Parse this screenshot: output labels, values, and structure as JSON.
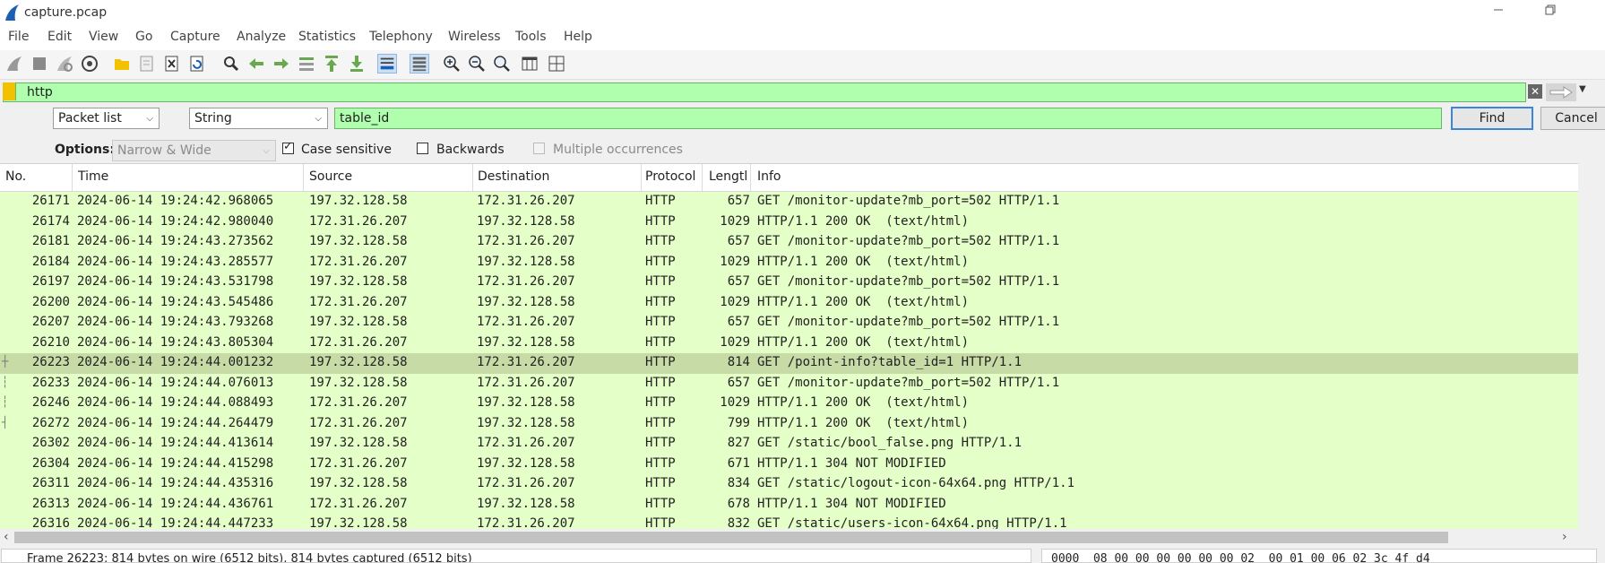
{
  "window": {
    "title": "capture.pcap"
  },
  "menu": [
    "File",
    "Edit",
    "View",
    "Go",
    "Capture",
    "Analyze",
    "Statistics",
    "Telephony",
    "Wireless",
    "Tools",
    "Help"
  ],
  "filter": {
    "value": "http"
  },
  "find": {
    "search_in": "Packet list",
    "search_type": "String",
    "value": "table_id",
    "find_label": "Find",
    "cancel_label": "Cancel",
    "options_label": "Options:",
    "char_width": "Narrow & Wide",
    "case_sensitive_label": "Case sensitive",
    "case_sensitive": true,
    "backwards_label": "Backwards",
    "backwards": false,
    "multiple_label": "Multiple occurrences",
    "multiple": false
  },
  "packet_list": {
    "columns": [
      "No.",
      "Time",
      "Source",
      "Destination",
      "Protocol",
      "Lengtl",
      "Info"
    ],
    "selected_index": 8,
    "rows": [
      {
        "no": "26171",
        "time": "2024-06-14 19:24:42.968065",
        "src": "197.32.128.58",
        "dst": "172.31.26.207",
        "proto": "HTTP",
        "len": "657",
        "info": "GET /monitor-update?mb_port=502 HTTP/1.1"
      },
      {
        "no": "26174",
        "time": "2024-06-14 19:24:42.980040",
        "src": "172.31.26.207",
        "dst": "197.32.128.58",
        "proto": "HTTP",
        "len": "1029",
        "info": "HTTP/1.1 200 OK  (text/html)"
      },
      {
        "no": "26181",
        "time": "2024-06-14 19:24:43.273562",
        "src": "197.32.128.58",
        "dst": "172.31.26.207",
        "proto": "HTTP",
        "len": "657",
        "info": "GET /monitor-update?mb_port=502 HTTP/1.1"
      },
      {
        "no": "26184",
        "time": "2024-06-14 19:24:43.285577",
        "src": "172.31.26.207",
        "dst": "197.32.128.58",
        "proto": "HTTP",
        "len": "1029",
        "info": "HTTP/1.1 200 OK  (text/html)"
      },
      {
        "no": "26197",
        "time": "2024-06-14 19:24:43.531798",
        "src": "197.32.128.58",
        "dst": "172.31.26.207",
        "proto": "HTTP",
        "len": "657",
        "info": "GET /monitor-update?mb_port=502 HTTP/1.1"
      },
      {
        "no": "26200",
        "time": "2024-06-14 19:24:43.545486",
        "src": "172.31.26.207",
        "dst": "197.32.128.58",
        "proto": "HTTP",
        "len": "1029",
        "info": "HTTP/1.1 200 OK  (text/html)"
      },
      {
        "no": "26207",
        "time": "2024-06-14 19:24:43.793268",
        "src": "197.32.128.58",
        "dst": "172.31.26.207",
        "proto": "HTTP",
        "len": "657",
        "info": "GET /monitor-update?mb_port=502 HTTP/1.1"
      },
      {
        "no": "26210",
        "time": "2024-06-14 19:24:43.805304",
        "src": "172.31.26.207",
        "dst": "197.32.128.58",
        "proto": "HTTP",
        "len": "1029",
        "info": "HTTP/1.1 200 OK  (text/html)"
      },
      {
        "no": "26223",
        "time": "2024-06-14 19:24:44.001232",
        "src": "197.32.128.58",
        "dst": "172.31.26.207",
        "proto": "HTTP",
        "len": "814",
        "info": "GET /point-info?table_id=1 HTTP/1.1"
      },
      {
        "no": "26233",
        "time": "2024-06-14 19:24:44.076013",
        "src": "197.32.128.58",
        "dst": "172.31.26.207",
        "proto": "HTTP",
        "len": "657",
        "info": "GET /monitor-update?mb_port=502 HTTP/1.1"
      },
      {
        "no": "26246",
        "time": "2024-06-14 19:24:44.088493",
        "src": "172.31.26.207",
        "dst": "197.32.128.58",
        "proto": "HTTP",
        "len": "1029",
        "info": "HTTP/1.1 200 OK  (text/html)"
      },
      {
        "no": "26272",
        "time": "2024-06-14 19:24:44.264479",
        "src": "172.31.26.207",
        "dst": "197.32.128.58",
        "proto": "HTTP",
        "len": "799",
        "info": "HTTP/1.1 200 OK  (text/html)"
      },
      {
        "no": "26302",
        "time": "2024-06-14 19:24:44.413614",
        "src": "197.32.128.58",
        "dst": "172.31.26.207",
        "proto": "HTTP",
        "len": "827",
        "info": "GET /static/bool_false.png HTTP/1.1"
      },
      {
        "no": "26304",
        "time": "2024-06-14 19:24:44.415298",
        "src": "172.31.26.207",
        "dst": "197.32.128.58",
        "proto": "HTTP",
        "len": "671",
        "info": "HTTP/1.1 304 NOT MODIFIED"
      },
      {
        "no": "26311",
        "time": "2024-06-14 19:24:44.435316",
        "src": "197.32.128.58",
        "dst": "172.31.26.207",
        "proto": "HTTP",
        "len": "834",
        "info": "GET /static/logout-icon-64x64.png HTTP/1.1"
      },
      {
        "no": "26313",
        "time": "2024-06-14 19:24:44.436761",
        "src": "172.31.26.207",
        "dst": "197.32.128.58",
        "proto": "HTTP",
        "len": "678",
        "info": "HTTP/1.1 304 NOT MODIFIED"
      },
      {
        "no": "26316",
        "time": "2024-06-14 19:24:44.447233",
        "src": "197.32.128.58",
        "dst": "172.31.26.207",
        "proto": "HTTP",
        "len": "832",
        "info": "GET /static/users-icon-64x64.png HTTP/1.1"
      }
    ]
  },
  "status": {
    "frame_summary": "Frame 26223: 814 bytes on wire (6512 bits), 814 bytes captured (6512 bits)",
    "hex_peek": "0000  08 00 00 00 00 00 00 02  00 01 00 06 02 3c 4f d4"
  },
  "colors": {
    "row_bg": "#e4ffc7",
    "selected_row_bg": "#c6dba6",
    "filter_ok_bg": "#afffaf"
  }
}
